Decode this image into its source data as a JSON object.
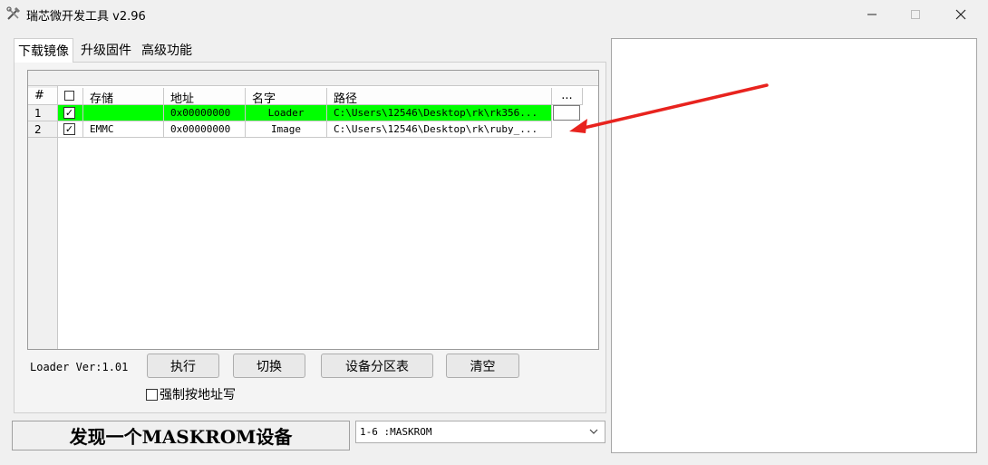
{
  "window": {
    "title": "瑞芯微开发工具 v2.96"
  },
  "tabs": [
    {
      "label": "下载镜像",
      "active": true
    },
    {
      "label": "升级固件",
      "active": false
    },
    {
      "label": "高级功能",
      "active": false
    }
  ],
  "table": {
    "columns": [
      "#",
      "",
      "存储",
      "地址",
      "名字",
      "路径",
      "..."
    ],
    "rows": [
      {
        "index": "1",
        "checked": true,
        "storage": "",
        "address": "0x00000000",
        "name": "Loader",
        "path": "C:\\Users\\12546\\Desktop\\rk\\rk356...",
        "highlight_color": "#00ff00"
      },
      {
        "index": "2",
        "checked": true,
        "storage": "EMMC",
        "address": "0x00000000",
        "name": "Image",
        "path": "C:\\Users\\12546\\Desktop\\rk\\ruby_..."
      }
    ]
  },
  "loader_version": "Loader Ver:1.01",
  "buttons": {
    "execute": "执行",
    "switch": "切换",
    "partition_table": "设备分区表",
    "clear": "清空"
  },
  "force_address_write": {
    "label": "强制按地址写",
    "checked": false
  },
  "status_text": "发现一个MASKROM设备",
  "device_select": {
    "value": "1-6 :MASKROM"
  },
  "colors": {
    "row_highlight": "#00ff00",
    "annotation_arrow": "#e8231e"
  },
  "icons": {
    "app": "tools-icon",
    "minimize": "minimize-icon",
    "maximize": "maximize-icon",
    "close": "close-icon"
  }
}
